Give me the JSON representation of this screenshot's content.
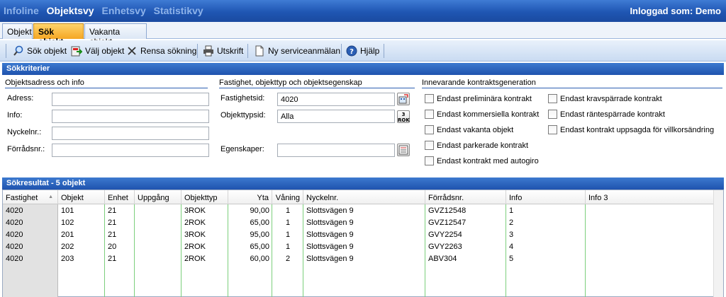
{
  "topnav": {
    "items": [
      {
        "label": "Infoline",
        "state": "muted"
      },
      {
        "label": "Objektsvy",
        "state": "active"
      },
      {
        "label": "Enhetsvy",
        "state": "muted"
      },
      {
        "label": "Statistikvy",
        "state": "muted"
      }
    ],
    "user": "Inloggad som: Demo"
  },
  "tabs": [
    {
      "label": "Objekt",
      "selected": false
    },
    {
      "label": "Sök objekt",
      "selected": true
    },
    {
      "label": "Vakanta objekt",
      "selected": false
    }
  ],
  "toolbar": {
    "search": "Sök objekt",
    "choose": "Välj objekt",
    "clear": "Rensa sökning",
    "print": "Utskrift",
    "service": "Ny serviceanmälan",
    "help": "Hjälp"
  },
  "criteria": {
    "title": "Sökkriterier",
    "group1": {
      "title": "Objektsadress och info",
      "address_label": "Adress:",
      "info_label": "Info:",
      "key_label": "Nyckelnr.:",
      "storage_label": "Förrådsnr.:"
    },
    "group2": {
      "title": "Fastighet, objekttyp och objektsegenskap",
      "property_label": "Fastighetsid:",
      "property_value": "4020",
      "type_label": "Objekttypsid:",
      "type_value": "Alla",
      "type_button_text": "3 ROK",
      "props_label": "Egenskaper:"
    },
    "group3": {
      "title": "Innevarande kontraktsgeneration",
      "checks_left": [
        "Endast preliminära kontrakt",
        "Endast kommersiella kontrakt",
        "Endast vakanta objekt",
        "Endast parkerade kontrakt",
        "Endast kontrakt med autogiro"
      ],
      "checks_right": [
        "Endast kravspärrade kontrakt",
        "Endast räntespärrade kontrakt",
        "Endast kontrakt uppsagda för villkorsändring"
      ]
    }
  },
  "results": {
    "title": "Sökresultat - 5 objekt",
    "columns": [
      "Fastighet",
      "Objekt",
      "Enhet",
      "Uppgång",
      "Objekttyp",
      "Yta",
      "Våning",
      "Nyckelnr.",
      "Förrådsnr.",
      "Info",
      "Info 3"
    ],
    "rows": [
      [
        "4020",
        "101",
        "21",
        "",
        "3ROK",
        "90,00",
        "1",
        "Slottsvägen 9",
        "GVZ12548",
        "1",
        ""
      ],
      [
        "4020",
        "102",
        "21",
        "",
        "2ROK",
        "65,00",
        "1",
        "Slottsvägen 9",
        "GVZ12547",
        "2",
        ""
      ],
      [
        "4020",
        "201",
        "21",
        "",
        "3ROK",
        "95,00",
        "1",
        "Slottsvägen 9",
        "GVY2254",
        "3",
        ""
      ],
      [
        "4020",
        "202",
        "20",
        "",
        "2ROK",
        "65,00",
        "1",
        "Slottsvägen 9",
        "GVY2263",
        "4",
        ""
      ],
      [
        "4020",
        "203",
        "21",
        "",
        "2ROK",
        "60,00",
        "2",
        "Slottsvägen 9",
        "ABV304",
        "5",
        ""
      ]
    ]
  },
  "colors": {
    "header_blue": "#1f56b3",
    "tab_selected": "#f5a623",
    "grid_divider": "#7ccf7c"
  }
}
